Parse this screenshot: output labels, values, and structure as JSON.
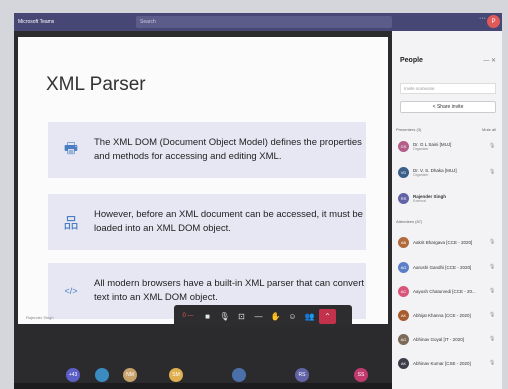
{
  "app": {
    "name": "Microsoft Teams",
    "search_placeholder": "Search",
    "menu_dots": "···",
    "user_initials": "P"
  },
  "slide": {
    "title": "XML Parser",
    "cards": [
      {
        "icon": "printer-icon",
        "glyph": "🖶",
        "text": "The XML DOM (Document Object Model) defines the properties and methods for accessing and editing XML."
      },
      {
        "icon": "hierarchy-icon",
        "glyph": "品",
        "text": "However, before an XML document can be accessed, it must be loaded into an XML DOM object."
      },
      {
        "icon": "code-icon",
        "glyph": "</>",
        "text": "All modern browsers have a built-in XML parser that can convert text into an XML DOM object."
      }
    ],
    "presenter_caption": "Rajender Singh"
  },
  "call_controls": {
    "timer": "0 —",
    "buttons": [
      {
        "name": "camera-button",
        "glyph": "■"
      },
      {
        "name": "mic-button",
        "glyph": "🎙"
      },
      {
        "name": "share-tray-button",
        "glyph": "⊡"
      },
      {
        "name": "more-actions-button",
        "glyph": "—"
      },
      {
        "name": "raise-hand-button",
        "glyph": "✋"
      },
      {
        "name": "reactions-button",
        "glyph": "☺"
      },
      {
        "name": "participants-button",
        "glyph": "👥"
      }
    ],
    "leave_glyph": "⌃"
  },
  "thumbnails": [
    {
      "label": "+43",
      "color": "#5b5fc7"
    },
    {
      "label": "",
      "color": "#3a8bbf"
    },
    {
      "label": "NM",
      "color": "#c7a26b"
    },
    {
      "label": "SM",
      "color": "#e0b050"
    },
    {
      "label": "",
      "color": "#4b6fa8"
    },
    {
      "label": "RS",
      "color": "#6264a7"
    },
    {
      "label": "SS",
      "color": "#c23a6d"
    }
  ],
  "people": {
    "title": "People",
    "invite_placeholder": "Invite someone",
    "share_label": "Share invite",
    "presenters_label": "Presenters (3)",
    "mute_all_label": "Mute all",
    "attendees_label": "Attendees (87)",
    "presenters": [
      {
        "name": "Dr. G L Saini [MUJ]",
        "role": "Organizer",
        "initials": "GS",
        "color": "#b35d8a"
      },
      {
        "name": "Dr. V. S. Dhaka [MUJ]",
        "role": "Organizer",
        "initials": "VD",
        "color": "#3a5f8a"
      },
      {
        "name": "Rajender Singh",
        "role": "External",
        "initials": "RS",
        "color": "#6264a7"
      }
    ],
    "attendees": [
      {
        "name": "Aakrit Bhargava [CCE - 2020]",
        "initials": "AB",
        "color": "#b06a3c"
      },
      {
        "name": "Aarushi Gandhi [CCE - 2020]",
        "initials": "AG",
        "color": "#5b7fc7"
      },
      {
        "name": "Aayush Chaturvedi [CCE - 20...",
        "initials": "AC",
        "color": "#d9557a"
      },
      {
        "name": "Abhijat Khanna [CCE - 2020]",
        "initials": "AK",
        "color": "#a65c2e"
      },
      {
        "name": "Abhinav Goyal [IT - 2020]",
        "initials": "AG",
        "color": "#7b6a5a"
      },
      {
        "name": "Abhinav Kumar [CSE - 2020]",
        "initials": "AK",
        "color": "#3d3d4a"
      }
    ]
  }
}
